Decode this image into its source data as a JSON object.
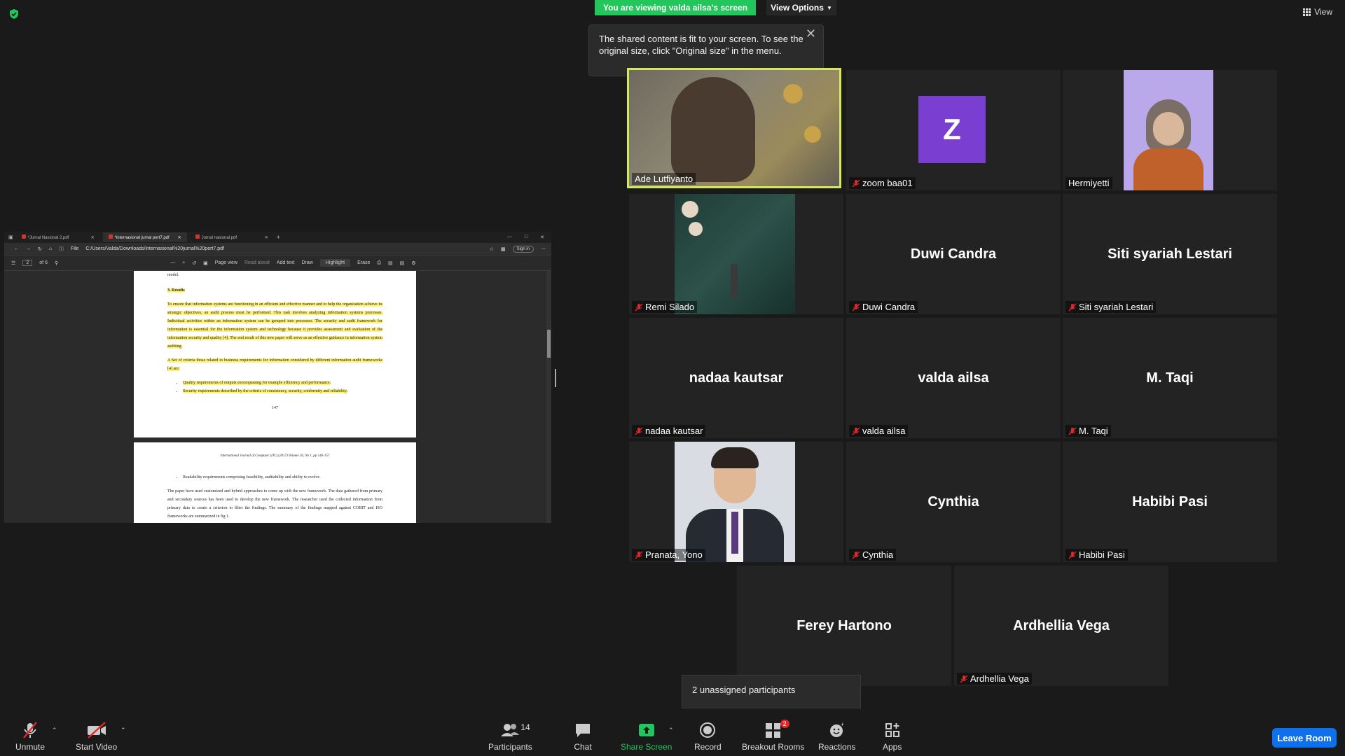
{
  "top": {
    "viewing_banner": "You are viewing valda ailsa's screen",
    "view_options": "View Options",
    "view_label": "View"
  },
  "tooltip": {
    "text": "The shared content is fit to your screen. To see the original size, click \"Original size\" in the menu."
  },
  "shared_screen": {
    "tabs": [
      "*Jurnal Nasional 2.pdf",
      "*internasional jurnal pert7.pdf",
      "Jurnal nasional.pdf"
    ],
    "file_label": "File",
    "url": "C:/Users/Valda/Downloads/internasional%20jurnal%20pert7.pdf",
    "sign_in": "Sign in",
    "page_number": "2",
    "page_total": "of 6",
    "tools": {
      "page_view": "Page view",
      "read_aloud": "Read aloud",
      "add_text": "Add text",
      "draw": "Draw",
      "highlight": "Highlight",
      "erase": "Erase"
    },
    "page1": {
      "top_word": "model.",
      "heading": "3. Results",
      "para1": "To ensure that information systems are functioning in an efficient and effective manner and to help the organization achieve its strategic objectives, an audit process must be performed. This task involves analyzing information systems processes. Individual activities within an information system can be grouped into processes. The security and audit framework for information is essential for the information system and technology because it provides assessment and evaluation of the information security and quality [4]. The end result of this new paper will serve as an effective guidance in information system auditing.",
      "para2": "A Set of criteria those related to business requirements for information considered by different information audit frameworks [4] are:",
      "bullet1": "Quality requirements of outputs encompassing for example efficiency and performance.",
      "bullet2": "Security requirements described by the criteria of consistency, security, conformity and reliability.",
      "page_num": "147"
    },
    "page2": {
      "header": "International Journal of Computer (IJC) (2017) Volume 26, No 1, pp 146-157",
      "bullet1": "Readability requirements comprising feasibility, auditability and ability to evolve.",
      "para1": "The paper have used customized and hybrid approaches to come up with the new framework. The data gathered from primary and secondary sources has been used to develop the new framework. The researcher used the collected information from primary data to create a criterion to filter the findings. The summary of the findings mapped against COBIT and ISO frameworks are summarized in fig 1."
    }
  },
  "participants_grid": [
    {
      "name": "Ade Lutfiyanto",
      "muted": false
    },
    {
      "name": "zoom baa01",
      "muted": true,
      "avatar_letter": "Z"
    },
    {
      "name": "Hermiyetti",
      "muted": false
    },
    {
      "name": "Remi Silado",
      "muted": true
    },
    {
      "name": "Duwi Candra",
      "muted": true
    },
    {
      "name": "Siti syariah Lestari",
      "muted": true
    },
    {
      "name": "nadaa kautsar",
      "muted": true
    },
    {
      "name": "valda ailsa",
      "muted": true
    },
    {
      "name": "M. Taqi",
      "muted": true
    },
    {
      "name": "Pranata, Yono",
      "muted": true
    },
    {
      "name": "Cynthia",
      "muted": true
    },
    {
      "name": "Habibi Pasi",
      "muted": true
    },
    {
      "name": "Ferey Hartono",
      "muted": true
    },
    {
      "name": "Ardhellia Vega",
      "muted": true
    }
  ],
  "unassigned": "2 unassigned participants",
  "toolbar": {
    "unmute": "Unmute",
    "start_video": "Start Video",
    "participants": "Participants",
    "participants_count": "14",
    "chat": "Chat",
    "share_screen": "Share Screen",
    "record": "Record",
    "breakout_rooms": "Breakout Rooms",
    "breakout_badge": "2",
    "reactions": "Reactions",
    "apps": "Apps",
    "leave": "Leave Room"
  },
  "colors": {
    "banner_green": "#23c65a",
    "leave_blue": "#0e71eb",
    "active_speaker_border": "#d4e95a",
    "avatar_purple": "#7a3fd0",
    "muted_red": "#e02828"
  }
}
